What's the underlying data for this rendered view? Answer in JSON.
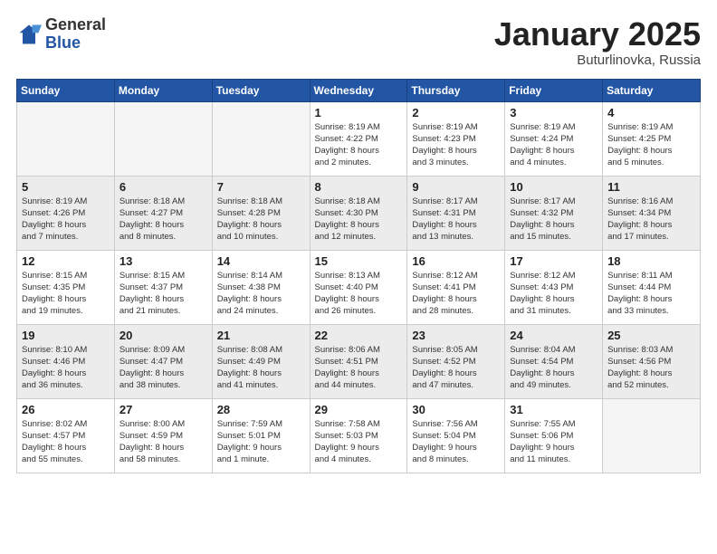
{
  "logo": {
    "general": "General",
    "blue": "Blue"
  },
  "title": "January 2025",
  "location": "Buturlinovka, Russia",
  "days_of_week": [
    "Sunday",
    "Monday",
    "Tuesday",
    "Wednesday",
    "Thursday",
    "Friday",
    "Saturday"
  ],
  "weeks": [
    [
      {
        "day": "",
        "info": ""
      },
      {
        "day": "",
        "info": ""
      },
      {
        "day": "",
        "info": ""
      },
      {
        "day": "1",
        "info": "Sunrise: 8:19 AM\nSunset: 4:22 PM\nDaylight: 8 hours\nand 2 minutes."
      },
      {
        "day": "2",
        "info": "Sunrise: 8:19 AM\nSunset: 4:23 PM\nDaylight: 8 hours\nand 3 minutes."
      },
      {
        "day": "3",
        "info": "Sunrise: 8:19 AM\nSunset: 4:24 PM\nDaylight: 8 hours\nand 4 minutes."
      },
      {
        "day": "4",
        "info": "Sunrise: 8:19 AM\nSunset: 4:25 PM\nDaylight: 8 hours\nand 5 minutes."
      }
    ],
    [
      {
        "day": "5",
        "info": "Sunrise: 8:19 AM\nSunset: 4:26 PM\nDaylight: 8 hours\nand 7 minutes."
      },
      {
        "day": "6",
        "info": "Sunrise: 8:18 AM\nSunset: 4:27 PM\nDaylight: 8 hours\nand 8 minutes."
      },
      {
        "day": "7",
        "info": "Sunrise: 8:18 AM\nSunset: 4:28 PM\nDaylight: 8 hours\nand 10 minutes."
      },
      {
        "day": "8",
        "info": "Sunrise: 8:18 AM\nSunset: 4:30 PM\nDaylight: 8 hours\nand 12 minutes."
      },
      {
        "day": "9",
        "info": "Sunrise: 8:17 AM\nSunset: 4:31 PM\nDaylight: 8 hours\nand 13 minutes."
      },
      {
        "day": "10",
        "info": "Sunrise: 8:17 AM\nSunset: 4:32 PM\nDaylight: 8 hours\nand 15 minutes."
      },
      {
        "day": "11",
        "info": "Sunrise: 8:16 AM\nSunset: 4:34 PM\nDaylight: 8 hours\nand 17 minutes."
      }
    ],
    [
      {
        "day": "12",
        "info": "Sunrise: 8:15 AM\nSunset: 4:35 PM\nDaylight: 8 hours\nand 19 minutes."
      },
      {
        "day": "13",
        "info": "Sunrise: 8:15 AM\nSunset: 4:37 PM\nDaylight: 8 hours\nand 21 minutes."
      },
      {
        "day": "14",
        "info": "Sunrise: 8:14 AM\nSunset: 4:38 PM\nDaylight: 8 hours\nand 24 minutes."
      },
      {
        "day": "15",
        "info": "Sunrise: 8:13 AM\nSunset: 4:40 PM\nDaylight: 8 hours\nand 26 minutes."
      },
      {
        "day": "16",
        "info": "Sunrise: 8:12 AM\nSunset: 4:41 PM\nDaylight: 8 hours\nand 28 minutes."
      },
      {
        "day": "17",
        "info": "Sunrise: 8:12 AM\nSunset: 4:43 PM\nDaylight: 8 hours\nand 31 minutes."
      },
      {
        "day": "18",
        "info": "Sunrise: 8:11 AM\nSunset: 4:44 PM\nDaylight: 8 hours\nand 33 minutes."
      }
    ],
    [
      {
        "day": "19",
        "info": "Sunrise: 8:10 AM\nSunset: 4:46 PM\nDaylight: 8 hours\nand 36 minutes."
      },
      {
        "day": "20",
        "info": "Sunrise: 8:09 AM\nSunset: 4:47 PM\nDaylight: 8 hours\nand 38 minutes."
      },
      {
        "day": "21",
        "info": "Sunrise: 8:08 AM\nSunset: 4:49 PM\nDaylight: 8 hours\nand 41 minutes."
      },
      {
        "day": "22",
        "info": "Sunrise: 8:06 AM\nSunset: 4:51 PM\nDaylight: 8 hours\nand 44 minutes."
      },
      {
        "day": "23",
        "info": "Sunrise: 8:05 AM\nSunset: 4:52 PM\nDaylight: 8 hours\nand 47 minutes."
      },
      {
        "day": "24",
        "info": "Sunrise: 8:04 AM\nSunset: 4:54 PM\nDaylight: 8 hours\nand 49 minutes."
      },
      {
        "day": "25",
        "info": "Sunrise: 8:03 AM\nSunset: 4:56 PM\nDaylight: 8 hours\nand 52 minutes."
      }
    ],
    [
      {
        "day": "26",
        "info": "Sunrise: 8:02 AM\nSunset: 4:57 PM\nDaylight: 8 hours\nand 55 minutes."
      },
      {
        "day": "27",
        "info": "Sunrise: 8:00 AM\nSunset: 4:59 PM\nDaylight: 8 hours\nand 58 minutes."
      },
      {
        "day": "28",
        "info": "Sunrise: 7:59 AM\nSunset: 5:01 PM\nDaylight: 9 hours\nand 1 minute."
      },
      {
        "day": "29",
        "info": "Sunrise: 7:58 AM\nSunset: 5:03 PM\nDaylight: 9 hours\nand 4 minutes."
      },
      {
        "day": "30",
        "info": "Sunrise: 7:56 AM\nSunset: 5:04 PM\nDaylight: 9 hours\nand 8 minutes."
      },
      {
        "day": "31",
        "info": "Sunrise: 7:55 AM\nSunset: 5:06 PM\nDaylight: 9 hours\nand 11 minutes."
      },
      {
        "day": "",
        "info": ""
      }
    ]
  ]
}
